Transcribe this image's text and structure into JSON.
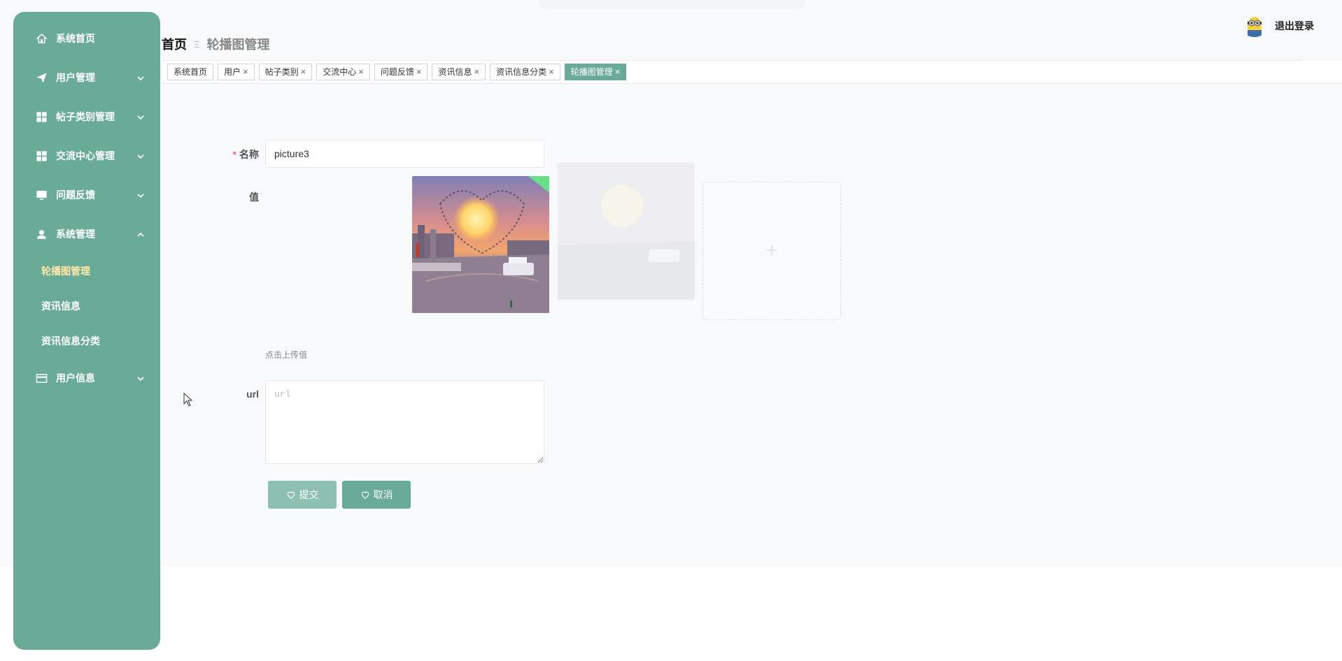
{
  "sidebar": {
    "items": [
      {
        "label": "系统首页",
        "icon": "home-icon"
      },
      {
        "label": "用户管理",
        "icon": "send-icon"
      },
      {
        "label": "帖子类别管理",
        "icon": "grid-icon"
      },
      {
        "label": "交流中心管理",
        "icon": "grid-icon"
      },
      {
        "label": "问题反馈",
        "icon": "monitor-icon"
      },
      {
        "label": "系统管理",
        "icon": "user-icon"
      },
      {
        "label": "用户信息",
        "icon": "card-icon"
      }
    ],
    "submenu": [
      {
        "label": "轮播图管理",
        "active": true
      },
      {
        "label": "资讯信息"
      },
      {
        "label": "资讯信息分类"
      }
    ]
  },
  "header": {
    "breadcrumb_home": "首页",
    "breadcrumb_sep": "Ξ",
    "breadcrumb_current": "轮播图管理",
    "logout": "退出登录"
  },
  "tags": [
    {
      "label": "系统首页",
      "closable": false
    },
    {
      "label": "用户",
      "closable": true
    },
    {
      "label": "帖子类别",
      "closable": true
    },
    {
      "label": "交流中心",
      "closable": true
    },
    {
      "label": "问题反馈",
      "closable": true
    },
    {
      "label": "资讯信息",
      "closable": true
    },
    {
      "label": "资讯信息分类",
      "closable": true
    },
    {
      "label": "轮播图管理",
      "closable": true,
      "active": true
    }
  ],
  "form": {
    "name_label": "名称",
    "name_required_mark": "*",
    "name_value": "picture3",
    "value_label": "值",
    "upload_plus": "+",
    "upload_tip": "点击上传值",
    "url_label": "url",
    "url_placeholder": "url",
    "submit_label": "提交",
    "cancel_label": "取消"
  },
  "colors": {
    "accent": "#6aab98",
    "accent_light": "#8dc0b0",
    "active_submenu": "#ffe9a8"
  }
}
